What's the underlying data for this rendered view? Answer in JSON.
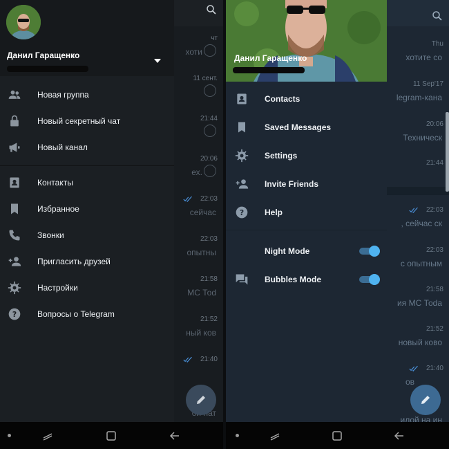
{
  "left_screen": {
    "user": {
      "name": "Данил Гаращенко"
    },
    "menu_groups": [
      [
        {
          "label": "Новая группа",
          "icon": "group-icon"
        },
        {
          "label": "Новый секретный чат",
          "icon": "lock-icon"
        },
        {
          "label": "Новый канал",
          "icon": "megaphone-icon"
        }
      ],
      [
        {
          "label": "Контакты",
          "icon": "contact-card-icon"
        },
        {
          "label": "Избранное",
          "icon": "bookmark-icon"
        },
        {
          "label": "Звонки",
          "icon": "phone-icon"
        },
        {
          "label": "Пригласить друзей",
          "icon": "add-person-icon"
        },
        {
          "label": "Настройки",
          "icon": "gear-icon"
        },
        {
          "label": "Вопросы о Telegram",
          "icon": "help-icon"
        }
      ]
    ],
    "background_chats": [
      {
        "time": "чт",
        "preview": "хоти"
      },
      {
        "time": "11 сент.",
        "preview": ""
      },
      {
        "time": "21:44",
        "preview": ""
      },
      {
        "time": "20:06",
        "preview": "ех."
      },
      {
        "time": "22:03",
        "preview": "сейчас"
      },
      {
        "time": "22:03",
        "preview": "опытны"
      },
      {
        "time": "21:58",
        "preview": "МС Тоd"
      },
      {
        "time": "21:52",
        "preview": "ный ков"
      },
      {
        "time": "21:40",
        "preview": ""
      },
      {
        "time": "",
        "preview": "ой нат"
      }
    ]
  },
  "right_screen": {
    "user": {
      "name": "Данил Гаращенко"
    },
    "menu_groups": [
      [
        {
          "label": "Contacts",
          "icon": "contact-card-icon"
        },
        {
          "label": "Saved Messages",
          "icon": "bookmark-icon"
        },
        {
          "label": "Settings",
          "icon": "gear-icon"
        },
        {
          "label": "Invite Friends",
          "icon": "add-person-icon"
        },
        {
          "label": "Help",
          "icon": "help-icon"
        }
      ],
      [
        {
          "label": "Night Mode",
          "icon": "moon-icon",
          "toggle": true
        },
        {
          "label": "Bubbles Mode",
          "icon": "chat-bubbles-icon",
          "toggle": true
        }
      ]
    ],
    "background_chats": [
      {
        "time": "Thu",
        "preview": "хотите со"
      },
      {
        "time": "11 Sep'17",
        "preview": "legram-кана"
      },
      {
        "time": "20:06",
        "preview": "Техническ"
      },
      {
        "time": "21:44",
        "preview": ""
      },
      {
        "time": "22:03",
        "preview": ", сейчас ск"
      },
      {
        "time": "22:03",
        "preview": "с опытным"
      },
      {
        "time": "21:58",
        "preview": "ия МС Тоdа"
      },
      {
        "time": "21:52",
        "preview": "новый ково"
      },
      {
        "time": "21:40",
        "preview": "ов"
      },
      {
        "time": "",
        "preview": "илой на ин"
      }
    ]
  },
  "colors": {
    "accent_toggle": "#4fb3f0",
    "read_check": "#4a90d9"
  }
}
